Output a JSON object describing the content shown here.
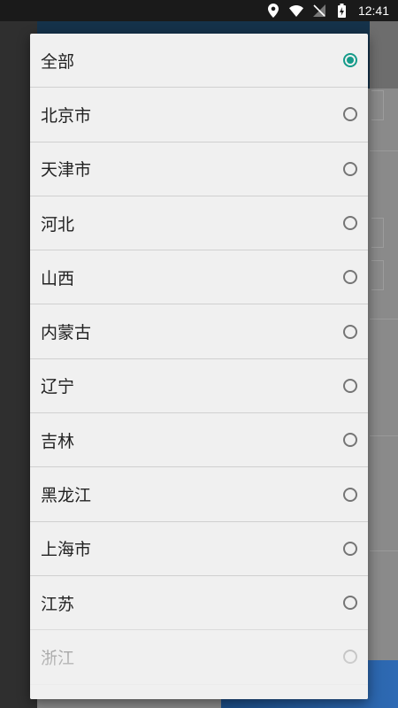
{
  "status_bar": {
    "time": "12:41",
    "icons": [
      "location-icon",
      "wifi-icon",
      "no-sim-icon",
      "battery-charging-icon"
    ]
  },
  "dialog": {
    "selected_index": 0,
    "accent_color": "#159b8a",
    "options": [
      {
        "label": "全部",
        "checked": true
      },
      {
        "label": "北京市",
        "checked": false
      },
      {
        "label": "天津市",
        "checked": false
      },
      {
        "label": "河北",
        "checked": false
      },
      {
        "label": "山西",
        "checked": false
      },
      {
        "label": "内蒙古",
        "checked": false
      },
      {
        "label": "辽宁",
        "checked": false
      },
      {
        "label": "吉林",
        "checked": false
      },
      {
        "label": "黑龙江",
        "checked": false
      },
      {
        "label": "上海市",
        "checked": false
      },
      {
        "label": "江苏",
        "checked": false
      },
      {
        "label": "浙江",
        "checked": false
      }
    ]
  }
}
